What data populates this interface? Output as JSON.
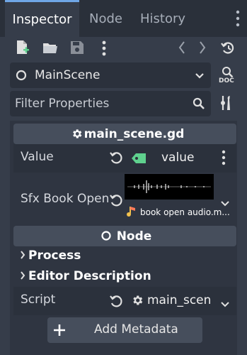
{
  "tabs": [
    {
      "label": "Inspector",
      "active": true
    },
    {
      "label": "Node",
      "active": false
    },
    {
      "label": "History",
      "active": false
    }
  ],
  "toolbar": {
    "icons": [
      "new-resource-icon",
      "open-folder-icon",
      "save-icon",
      "more-options-icon",
      "back-icon",
      "forward-icon",
      "history-icon"
    ]
  },
  "scene_selector": {
    "value": "MainScene",
    "doc_label": "DOC"
  },
  "filter": {
    "placeholder": "Filter Properties"
  },
  "script_section": {
    "title": "main_scene.gd"
  },
  "properties": {
    "value": {
      "label": "Value",
      "text": "value"
    },
    "sfx": {
      "label": "Sfx Book Open",
      "file": "book open audio.m..."
    }
  },
  "node_section": {
    "title": "Node",
    "groups": [
      "Process",
      "Editor Description"
    ],
    "script": {
      "label": "Script",
      "value": "main_scen"
    }
  },
  "add_metadata": {
    "label": "Add Metadata"
  },
  "colors": {
    "accent": "#6fa6e6",
    "background": "#363d4a",
    "tag_green": "#5fd18e"
  }
}
